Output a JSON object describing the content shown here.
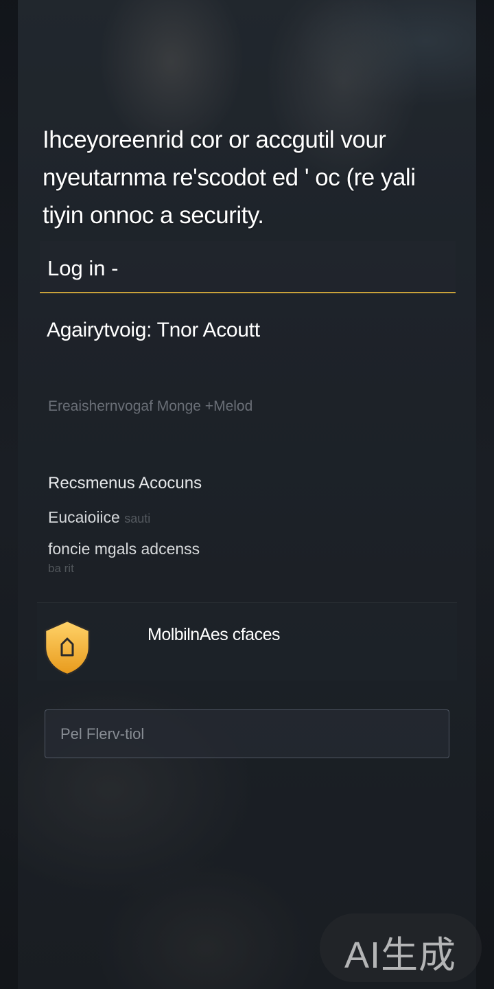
{
  "headline": "Ihceyoreenrid cor or accgutil vour nyeutarnma re'scodot ed ' oc (re yali tiyin onnoc a security.",
  "login_tab": {
    "label": "Log in -"
  },
  "account_section": {
    "title": "Agairytvoig: Tnor Acoutt",
    "faint_text": "Ereaishernvogaf Monge +Melod"
  },
  "recent": {
    "title": "Recsmenus Acocuns",
    "subtitle": "Eucaioiice",
    "subtitle_faint": "sauti",
    "description": "foncie mgals adcenss",
    "description_faint": "ba rit"
  },
  "security_card": {
    "icon": "shield-lock-icon",
    "label": "MolbilnAes cfaces",
    "icon_color": "#f5b835"
  },
  "input": {
    "placeholder": "Pel Flerv-tiol",
    "value": ""
  },
  "watermark": {
    "text": "AI生成"
  },
  "colors": {
    "accent": "#c9a23a",
    "background": "#1c2026"
  }
}
